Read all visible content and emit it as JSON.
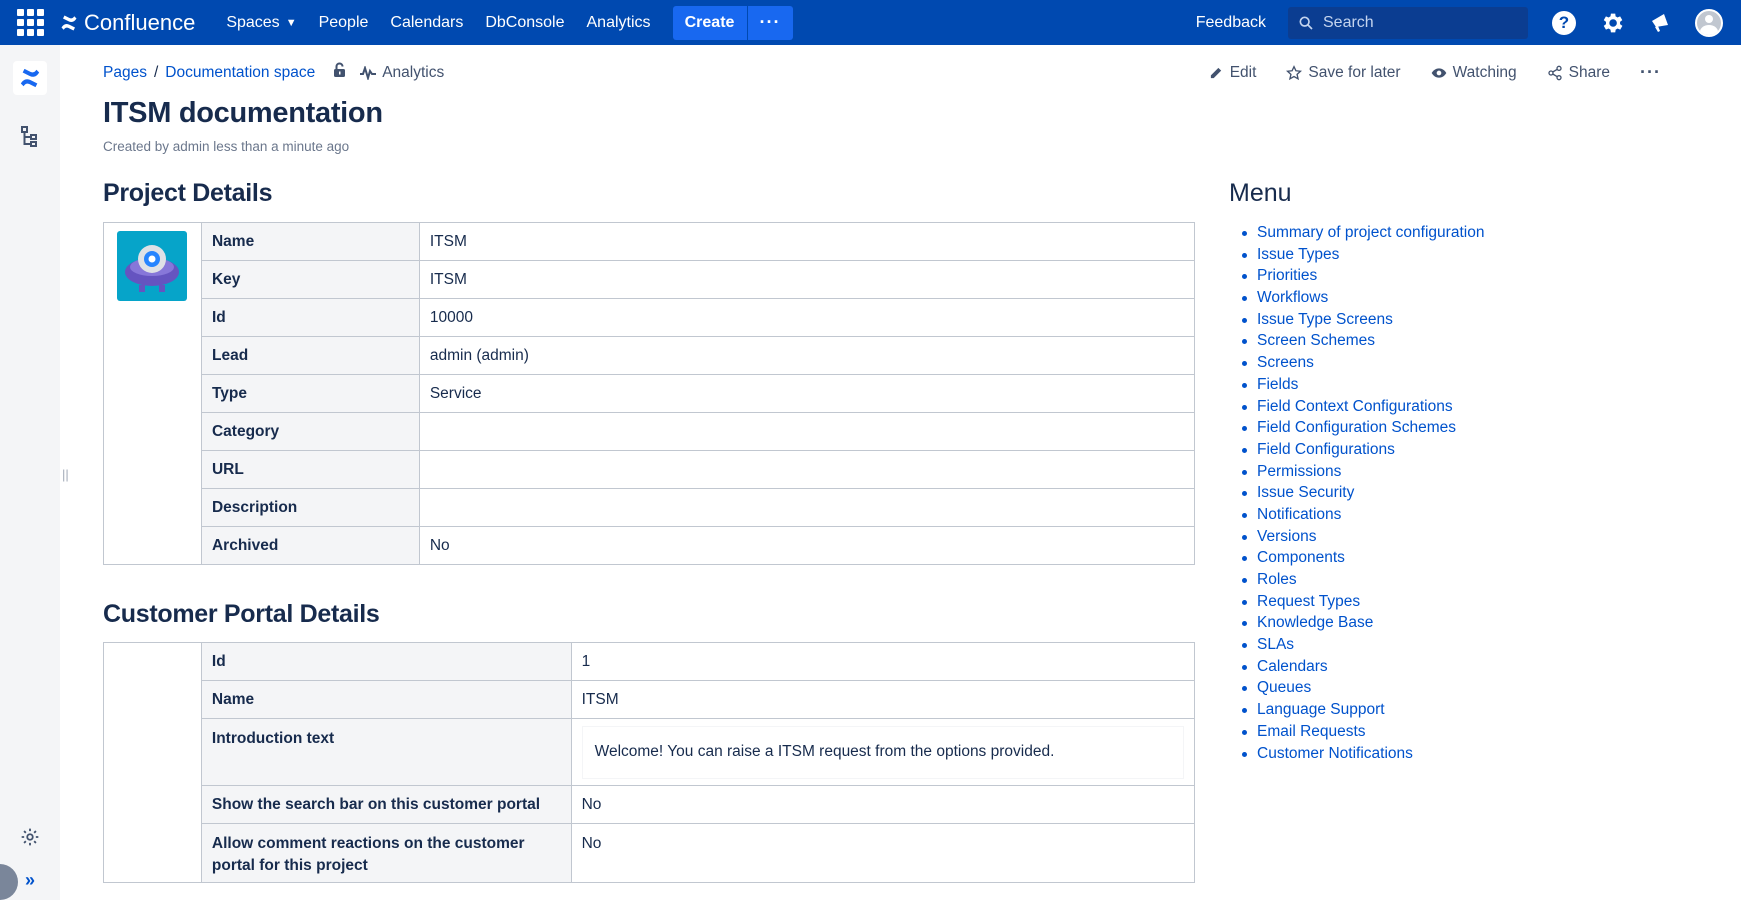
{
  "topnav": {
    "product": "Confluence",
    "items": [
      "Spaces",
      "People",
      "Calendars",
      "DbConsole",
      "Analytics"
    ],
    "create_label": "Create",
    "more_label": "···",
    "feedback_label": "Feedback",
    "search_placeholder": "Search"
  },
  "breadcrumb": {
    "pages": "Pages",
    "separator": "/",
    "space": "Documentation space",
    "analytics": "Analytics"
  },
  "actions": {
    "edit": "Edit",
    "save_for_later": "Save for later",
    "watching": "Watching",
    "share": "Share",
    "more": "···"
  },
  "page": {
    "title": "ITSM documentation",
    "created": "Created by admin less than a minute ago"
  },
  "project_details": {
    "heading": "Project Details",
    "rows": [
      {
        "key": "Name",
        "value": "ITSM"
      },
      {
        "key": "Key",
        "value": "ITSM"
      },
      {
        "key": "Id",
        "value": "10000"
      },
      {
        "key": "Lead",
        "value": "admin (admin)"
      },
      {
        "key": "Type",
        "value": "Service"
      },
      {
        "key": "Category",
        "value": ""
      },
      {
        "key": "URL",
        "value": ""
      },
      {
        "key": "Description",
        "value": ""
      },
      {
        "key": "Archived",
        "value": "No"
      }
    ]
  },
  "portal_details": {
    "heading": "Customer Portal Details",
    "rows": [
      {
        "key": "Id",
        "value": "1"
      },
      {
        "key": "Name",
        "value": "ITSM"
      },
      {
        "key": "Introduction text",
        "value": "Welcome! You can raise a ITSM request from the options provided."
      },
      {
        "key": "Show the search bar on this customer portal",
        "value": "No"
      },
      {
        "key": "Allow comment reactions on the customer portal for this project",
        "value": "No"
      }
    ]
  },
  "menu": {
    "heading": "Menu",
    "items": [
      "Summary of project configuration",
      "Issue Types",
      "Priorities",
      "Workflows",
      "Issue Type Screens",
      "Screen Schemes",
      "Screens",
      "Fields",
      "Field Context Configurations",
      "Field Configuration Schemes",
      "Field Configurations",
      "Permissions",
      "Issue Security",
      "Notifications",
      "Versions",
      "Components",
      "Roles",
      "Request Types",
      "Knowledge Base",
      "SLAs",
      "Calendars",
      "Queues",
      "Language Support",
      "Email Requests",
      "Customer Notifications"
    ]
  },
  "colors": {
    "nav_bg": "#0049b0",
    "create_bg": "#1868f0",
    "link": "#0052cc",
    "text": "#172b4d",
    "table_key_bg": "#f4f5f7"
  }
}
